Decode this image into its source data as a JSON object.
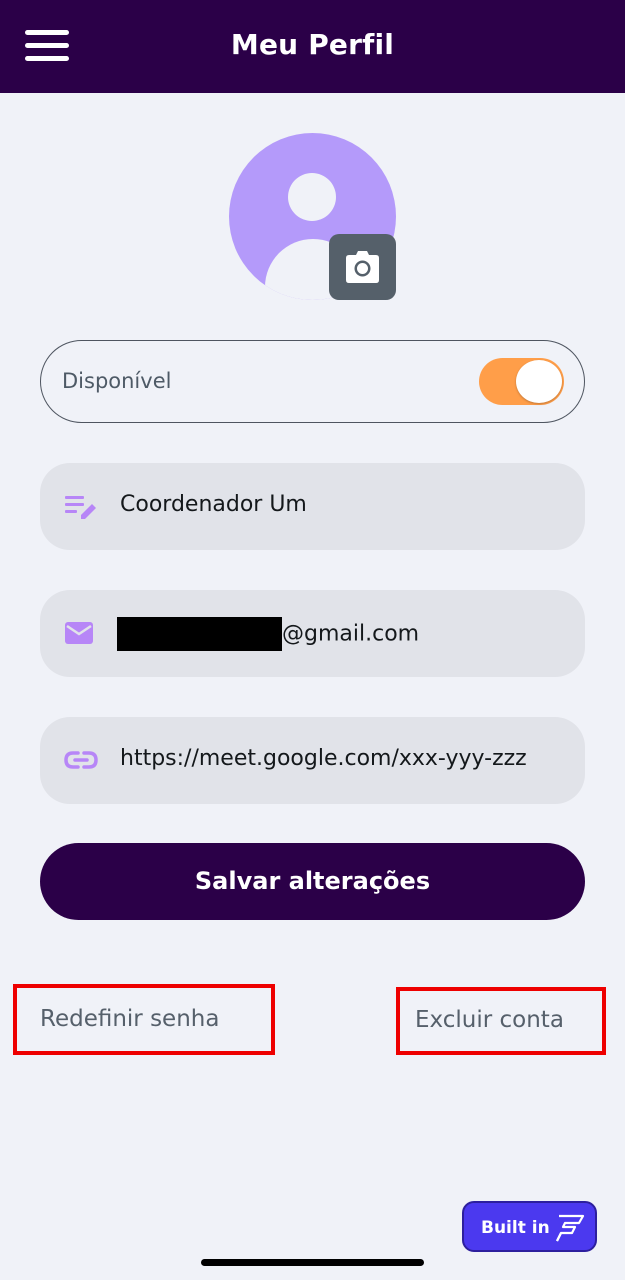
{
  "header": {
    "title": "Meu Perfil",
    "menu_icon": "hamburger-menu-icon"
  },
  "avatar": {
    "icon": "user-avatar-icon",
    "color": "#b49afa",
    "camera_icon": "camera-icon"
  },
  "status": {
    "label": "Disponível",
    "toggle_on": true,
    "toggle_color": "#ff9e49"
  },
  "fields": {
    "name": {
      "icon": "edit-notes-icon",
      "value": "Coordenador Um"
    },
    "email": {
      "icon": "mail-icon",
      "value_visible": "@gmail.com",
      "redacted": true
    },
    "link": {
      "icon": "link-icon",
      "value": "https://meet.google.com/xxx-yyy-zzz"
    }
  },
  "actions": {
    "save_label": "Salvar alterações",
    "reset_password_label": "Redefinir senha",
    "delete_account_label": "Excluir conta"
  },
  "badge": {
    "label": "Built in",
    "icon": "flutterflow-logo-icon"
  },
  "colors": {
    "primary": "#2b0048",
    "background": "#f0f2f8",
    "accent_icon": "#b786f7",
    "highlight_border": "#ee0000",
    "badge": "#4b39ef"
  }
}
